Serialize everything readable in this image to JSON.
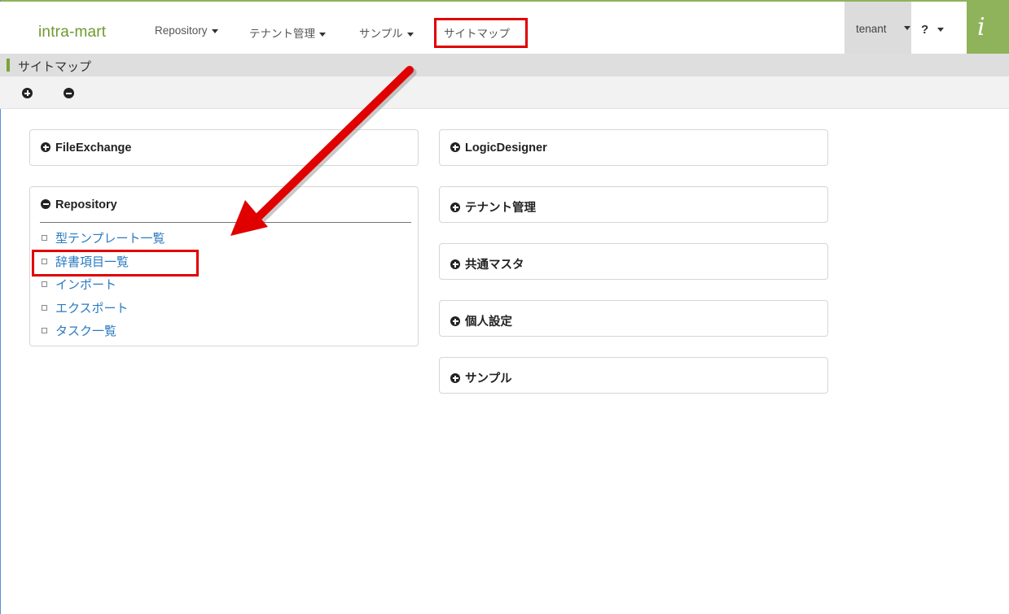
{
  "navbar": {
    "brand": "intra-mart",
    "menus": [
      {
        "label": "Repository"
      },
      {
        "label": "テナント管理"
      },
      {
        "label": "サンプル"
      }
    ],
    "sitemap_label": "サイトマップ",
    "user": "tenant",
    "help": "?",
    "logo": "i"
  },
  "page": {
    "title": "サイトマップ"
  },
  "left_panels": [
    {
      "title": "FileExchange",
      "expanded": false
    },
    {
      "title": "Repository",
      "expanded": true,
      "items": [
        "型テンプレート一覧",
        "辞書項目一覧",
        "インポート",
        "エクスポート",
        "タスク一覧"
      ]
    }
  ],
  "right_panels": [
    {
      "title": "LogicDesigner"
    },
    {
      "title": "テナント管理"
    },
    {
      "title": "共通マスタ"
    },
    {
      "title": "個人設定"
    },
    {
      "title": "サンプル"
    }
  ],
  "colors": {
    "accent_green": "#8fb35a",
    "link_blue": "#2a7ac0",
    "annotation_red": "#e00000"
  }
}
